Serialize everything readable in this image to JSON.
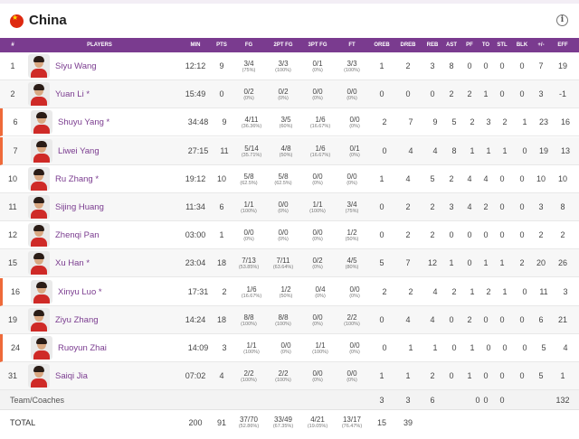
{
  "team": {
    "name": "China"
  },
  "columns": [
    "#",
    "PLAYERS",
    "MIN",
    "PTS",
    "FG",
    "2PT FG",
    "3PT FG",
    "FT",
    "OREB",
    "DREB",
    "REB",
    "AST",
    "PF",
    "TO",
    "STL",
    "BLK",
    "+/-",
    "EFF"
  ],
  "players": [
    {
      "num": "1",
      "name": "Siyu Wang",
      "starter": false,
      "min": "12:12",
      "pts": "9",
      "fg": "3/4",
      "fg_pct": "(75%)",
      "fg2": "3/3",
      "fg2_pct": "(100%)",
      "fg3": "0/1",
      "fg3_pct": "(0%)",
      "ft": "3/3",
      "ft_pct": "(100%)",
      "oreb": "1",
      "dreb": "2",
      "reb": "3",
      "ast": "8",
      "pf": "0",
      "to": "0",
      "stl": "0",
      "blk": "0",
      "pm": "7",
      "eff": "19"
    },
    {
      "num": "2",
      "name": "Yuan Li *",
      "starter": false,
      "min": "15:49",
      "pts": "0",
      "fg": "0/2",
      "fg_pct": "(0%)",
      "fg2": "0/2",
      "fg2_pct": "(0%)",
      "fg3": "0/0",
      "fg3_pct": "(0%)",
      "ft": "0/0",
      "ft_pct": "(0%)",
      "oreb": "0",
      "dreb": "0",
      "reb": "0",
      "ast": "2",
      "pf": "2",
      "to": "1",
      "stl": "0",
      "blk": "0",
      "pm": "3",
      "eff": "-1"
    },
    {
      "num": "6",
      "name": "Shuyu Yang *",
      "starter": true,
      "min": "34:48",
      "pts": "9",
      "fg": "4/11",
      "fg_pct": "(36.36%)",
      "fg2": "3/5",
      "fg2_pct": "(60%)",
      "fg3": "1/6",
      "fg3_pct": "(16.67%)",
      "ft": "0/0",
      "ft_pct": "(0%)",
      "oreb": "2",
      "dreb": "7",
      "reb": "9",
      "ast": "5",
      "pf": "2",
      "to": "3",
      "stl": "2",
      "blk": "1",
      "pm": "23",
      "eff": "16"
    },
    {
      "num": "7",
      "name": "Liwei Yang",
      "starter": true,
      "min": "27:15",
      "pts": "11",
      "fg": "5/14",
      "fg_pct": "(35.71%)",
      "fg2": "4/8",
      "fg2_pct": "(50%)",
      "fg3": "1/6",
      "fg3_pct": "(16.67%)",
      "ft": "0/1",
      "ft_pct": "(0%)",
      "oreb": "0",
      "dreb": "4",
      "reb": "4",
      "ast": "8",
      "pf": "1",
      "to": "1",
      "stl": "1",
      "blk": "0",
      "pm": "19",
      "eff": "13"
    },
    {
      "num": "10",
      "name": "Ru Zhang *",
      "starter": false,
      "min": "19:12",
      "pts": "10",
      "fg": "5/8",
      "fg_pct": "(62.5%)",
      "fg2": "5/8",
      "fg2_pct": "(62.5%)",
      "fg3": "0/0",
      "fg3_pct": "(0%)",
      "ft": "0/0",
      "ft_pct": "(0%)",
      "oreb": "1",
      "dreb": "4",
      "reb": "5",
      "ast": "2",
      "pf": "4",
      "to": "4",
      "stl": "0",
      "blk": "0",
      "pm": "10",
      "eff": "10"
    },
    {
      "num": "11",
      "name": "Sijing Huang",
      "starter": false,
      "min": "11:34",
      "pts": "6",
      "fg": "1/1",
      "fg_pct": "(100%)",
      "fg2": "0/0",
      "fg2_pct": "(0%)",
      "fg3": "1/1",
      "fg3_pct": "(100%)",
      "ft": "3/4",
      "ft_pct": "(75%)",
      "oreb": "0",
      "dreb": "2",
      "reb": "2",
      "ast": "3",
      "pf": "4",
      "to": "2",
      "stl": "0",
      "blk": "0",
      "pm": "3",
      "eff": "8"
    },
    {
      "num": "12",
      "name": "Zhenqi Pan",
      "starter": false,
      "min": "03:00",
      "pts": "1",
      "fg": "0/0",
      "fg_pct": "(0%)",
      "fg2": "0/0",
      "fg2_pct": "(0%)",
      "fg3": "0/0",
      "fg3_pct": "(0%)",
      "ft": "1/2",
      "ft_pct": "(50%)",
      "oreb": "0",
      "dreb": "2",
      "reb": "2",
      "ast": "0",
      "pf": "0",
      "to": "0",
      "stl": "0",
      "blk": "0",
      "pm": "2",
      "eff": "2"
    },
    {
      "num": "15",
      "name": "Xu Han *",
      "starter": false,
      "min": "23:04",
      "pts": "18",
      "fg": "7/13",
      "fg_pct": "(53.85%)",
      "fg2": "7/11",
      "fg2_pct": "(63.64%)",
      "fg3": "0/2",
      "fg3_pct": "(0%)",
      "ft": "4/5",
      "ft_pct": "(80%)",
      "oreb": "5",
      "dreb": "7",
      "reb": "12",
      "ast": "1",
      "pf": "0",
      "to": "1",
      "stl": "1",
      "blk": "2",
      "pm": "20",
      "eff": "26"
    },
    {
      "num": "16",
      "name": "Xinyu Luo *",
      "starter": true,
      "min": "17:31",
      "pts": "2",
      "fg": "1/6",
      "fg_pct": "(16.67%)",
      "fg2": "1/2",
      "fg2_pct": "(50%)",
      "fg3": "0/4",
      "fg3_pct": "(0%)",
      "ft": "0/0",
      "ft_pct": "(0%)",
      "oreb": "2",
      "dreb": "2",
      "reb": "4",
      "ast": "2",
      "pf": "1",
      "to": "2",
      "stl": "1",
      "blk": "0",
      "pm": "11",
      "eff": "3"
    },
    {
      "num": "19",
      "name": "Ziyu Zhang",
      "starter": false,
      "min": "14:24",
      "pts": "18",
      "fg": "8/8",
      "fg_pct": "(100%)",
      "fg2": "8/8",
      "fg2_pct": "(100%)",
      "fg3": "0/0",
      "fg3_pct": "(0%)",
      "ft": "2/2",
      "ft_pct": "(100%)",
      "oreb": "0",
      "dreb": "4",
      "reb": "4",
      "ast": "0",
      "pf": "2",
      "to": "0",
      "stl": "0",
      "blk": "0",
      "pm": "6",
      "eff": "21"
    },
    {
      "num": "24",
      "name": "Ruoyun Zhai",
      "starter": true,
      "min": "14:09",
      "pts": "3",
      "fg": "1/1",
      "fg_pct": "(100%)",
      "fg2": "0/0",
      "fg2_pct": "(0%)",
      "fg3": "1/1",
      "fg3_pct": "(100%)",
      "ft": "0/0",
      "ft_pct": "(0%)",
      "oreb": "0",
      "dreb": "1",
      "reb": "1",
      "ast": "0",
      "pf": "1",
      "to": "0",
      "stl": "0",
      "blk": "0",
      "pm": "5",
      "eff": "4"
    },
    {
      "num": "31",
      "name": "Saiqi Jia",
      "starter": false,
      "min": "07:02",
      "pts": "4",
      "fg": "2/2",
      "fg_pct": "(100%)",
      "fg2": "2/2",
      "fg2_pct": "(100%)",
      "fg3": "0/0",
      "fg3_pct": "(0%)",
      "ft": "0/0",
      "ft_pct": "(0%)",
      "oreb": "1",
      "dreb": "1",
      "reb": "2",
      "ast": "0",
      "pf": "1",
      "to": "0",
      "stl": "0",
      "blk": "0",
      "pm": "5",
      "eff": "1"
    }
  ],
  "coaches": {
    "label": "Team/Coaches",
    "oreb": "3",
    "dreb": "3",
    "reb": "6",
    "pf": "0",
    "to": "0",
    "stl": "0",
    "eff": "132"
  },
  "total": {
    "label": "TOTAL",
    "min": "200",
    "pts": "91",
    "fg": "37/70",
    "fg_pct": "(52.86%)",
    "fg2": "33/49",
    "fg2_pct": "(67.35%)",
    "fg3": "4/21",
    "fg3_pct": "(19.05%)",
    "ft": "13/17",
    "ft_pct": "(76.47%)",
    "oreb": "15",
    "dreb": "39"
  },
  "colors": {
    "header_bg": "#7a3b8f",
    "player_link": "#7a3b8f",
    "starter_accent": "#ef6a3a",
    "flag_red": "#de2910"
  },
  "icons": {
    "flag": "china-flag-icon",
    "info": "info-icon"
  }
}
